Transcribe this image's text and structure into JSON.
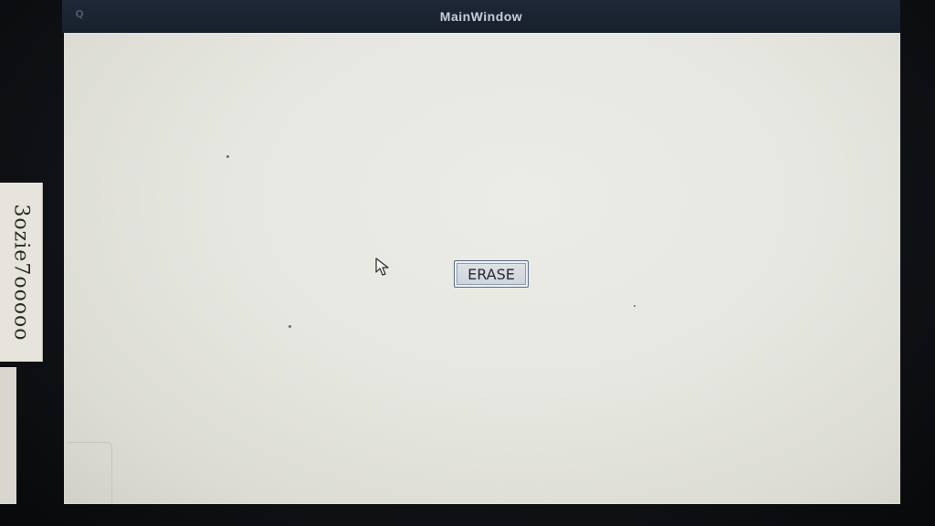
{
  "window": {
    "title": "MainWindow",
    "app_icon": "qt-icon"
  },
  "main": {
    "erase_button_label": "ERASE"
  },
  "colors": {
    "titlebar": "#1b2430",
    "client_background": "#e8e8e3",
    "button_border": "#5b6e86"
  },
  "icons": {
    "pointer": "mouse-pointer-icon",
    "app": "qt-icon"
  }
}
